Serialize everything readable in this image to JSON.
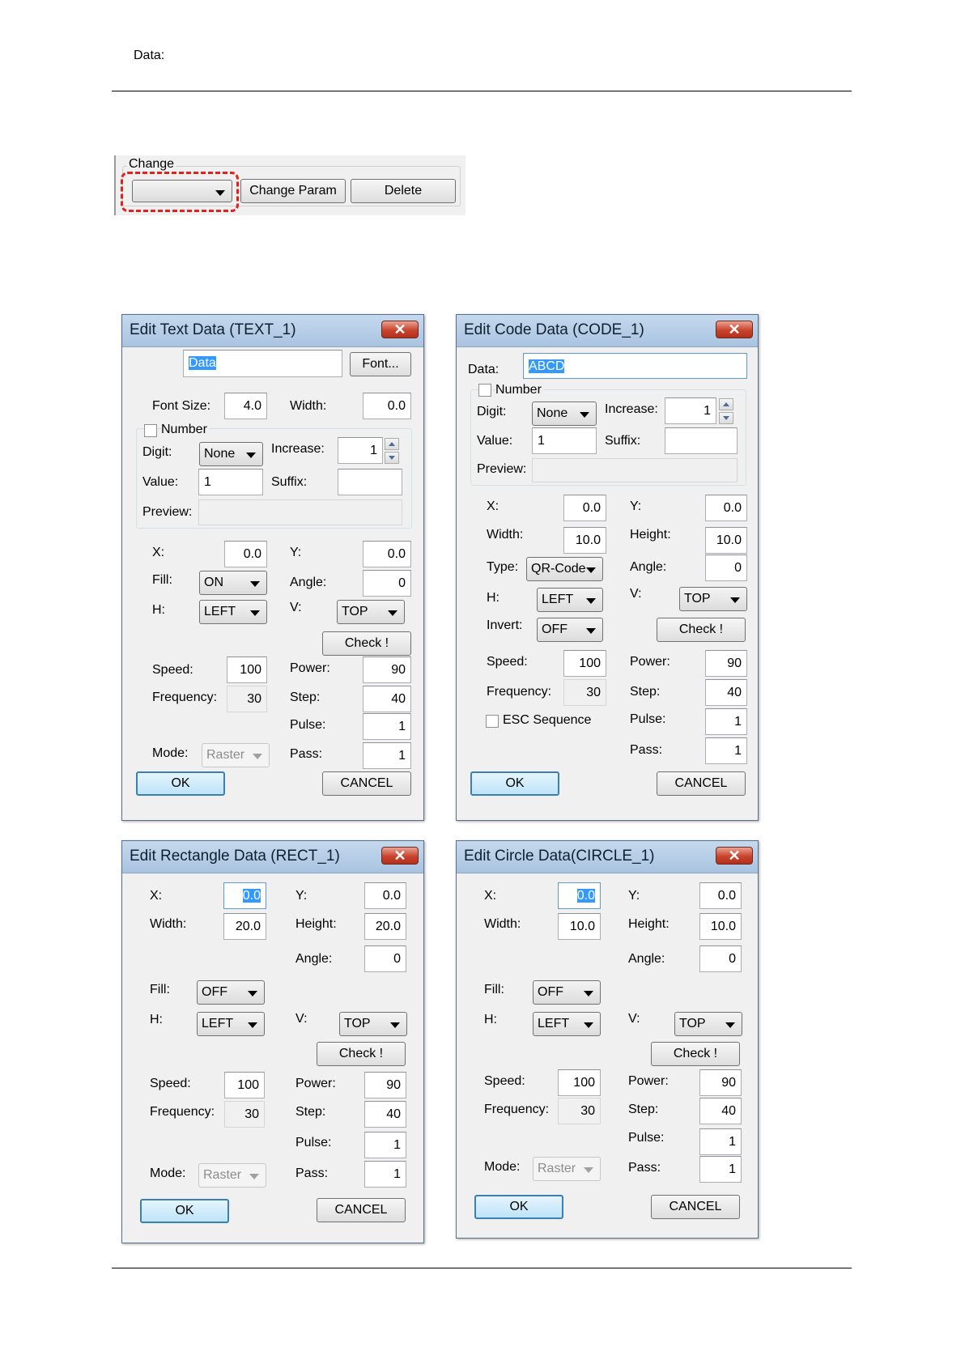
{
  "change_panel": {
    "group_label": "Change",
    "change_param_label": "Change Param",
    "delete_label": "Delete",
    "selector_value": ""
  },
  "common": {
    "x": "X:",
    "y": "Y:",
    "width": "Width:",
    "height": "Height:",
    "angle": "Angle:",
    "fill": "Fill:",
    "h": "H:",
    "v": "V:",
    "check": "Check !",
    "speed": "Speed:",
    "power": "Power:",
    "frequency": "Frequency:",
    "step": "Step:",
    "pulse": "Pulse:",
    "pass": "Pass:",
    "mode": "Mode:",
    "ok": "OK",
    "cancel": "CANCEL",
    "close": "✕",
    "number": "Number",
    "digit": "Digit:",
    "increase": "Increase:",
    "value": "Value:",
    "suffix": "Suffix:",
    "preview": "Preview:",
    "data": "Data:"
  },
  "text_dialog": {
    "title": "Edit Text Data (TEXT_1)",
    "data_value": "Data",
    "font_button": "Font...",
    "font_size_label": "Font Size:",
    "font_size": "4.0",
    "width": "0.0",
    "digit": "None",
    "increase": "1",
    "value": "1",
    "suffix": "",
    "preview": "",
    "x": "0.0",
    "y": "0.0",
    "fill": "ON",
    "angle": "0",
    "h": "LEFT",
    "v": "TOP",
    "speed": "100",
    "power": "90",
    "frequency": "30",
    "step": "40",
    "pulse": "1",
    "mode": "Raster",
    "pass": "1"
  },
  "code_dialog": {
    "title": "Edit Code Data (CODE_1)",
    "data_value": "ABCD",
    "digit": "None",
    "increase": "1",
    "value": "1",
    "suffix": "",
    "preview": "",
    "x": "0.0",
    "y": "0.0",
    "width": "10.0",
    "height": "10.0",
    "type_label": "Type:",
    "type": "QR-Code",
    "angle": "0",
    "h": "LEFT",
    "v": "TOP",
    "invert_label": "Invert:",
    "invert": "OFF",
    "speed": "100",
    "power": "90",
    "frequency": "30",
    "step": "40",
    "esc_label": "ESC Sequence",
    "pulse": "1",
    "pass": "1"
  },
  "rect_dialog": {
    "title": "Edit Rectangle Data (RECT_1)",
    "x": "0.0",
    "y": "0.0",
    "width": "20.0",
    "height": "20.0",
    "angle": "0",
    "fill": "OFF",
    "h": "LEFT",
    "v": "TOP",
    "speed": "100",
    "power": "90",
    "frequency": "30",
    "step": "40",
    "pulse": "1",
    "mode": "Raster",
    "pass": "1"
  },
  "circle_dialog": {
    "title": "Edit Circle Data(CIRCLE_1)",
    "x": "0.0",
    "y": "0.0",
    "width": "10.0",
    "height": "10.0",
    "angle": "0",
    "fill": "OFF",
    "h": "LEFT",
    "v": "TOP",
    "speed": "100",
    "power": "90",
    "frequency": "30",
    "step": "40",
    "pulse": "1",
    "mode": "Raster",
    "pass": "1"
  }
}
